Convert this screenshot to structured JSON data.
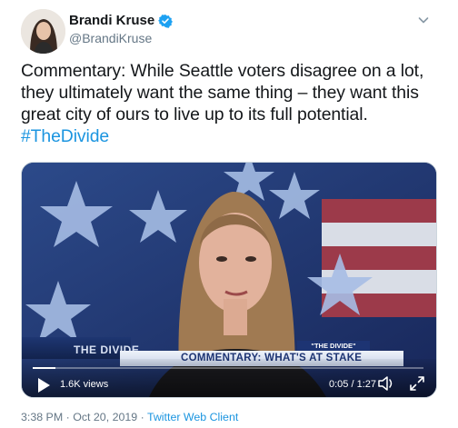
{
  "author": {
    "display_name": "Brandi Kruse",
    "handle": "@BrandiKruse",
    "verified": true,
    "avatar_icon": "profile-photo"
  },
  "tweet": {
    "text": "Commentary: While Seattle voters disagree on a lot, they ultimately want the same thing – they want this great city of ours to live up to its full potential.",
    "hashtag": "#TheDivide"
  },
  "video": {
    "show_tag": "THE DIVIDE",
    "chyron_text": "COMMENTARY: WHAT'S AT STAKE",
    "tag_box": "\"THE DIVIDE\"",
    "views": "1.6K views",
    "time": "0:05 / 1:27",
    "progress": 0.057
  },
  "meta": {
    "time": "3:38 PM",
    "separator": "·",
    "date": "Oct 20, 2019",
    "client": "Twitter Web Client"
  },
  "colors": {
    "link": "#1b95e0",
    "muted": "#657786",
    "verified": "#1da1f2"
  }
}
